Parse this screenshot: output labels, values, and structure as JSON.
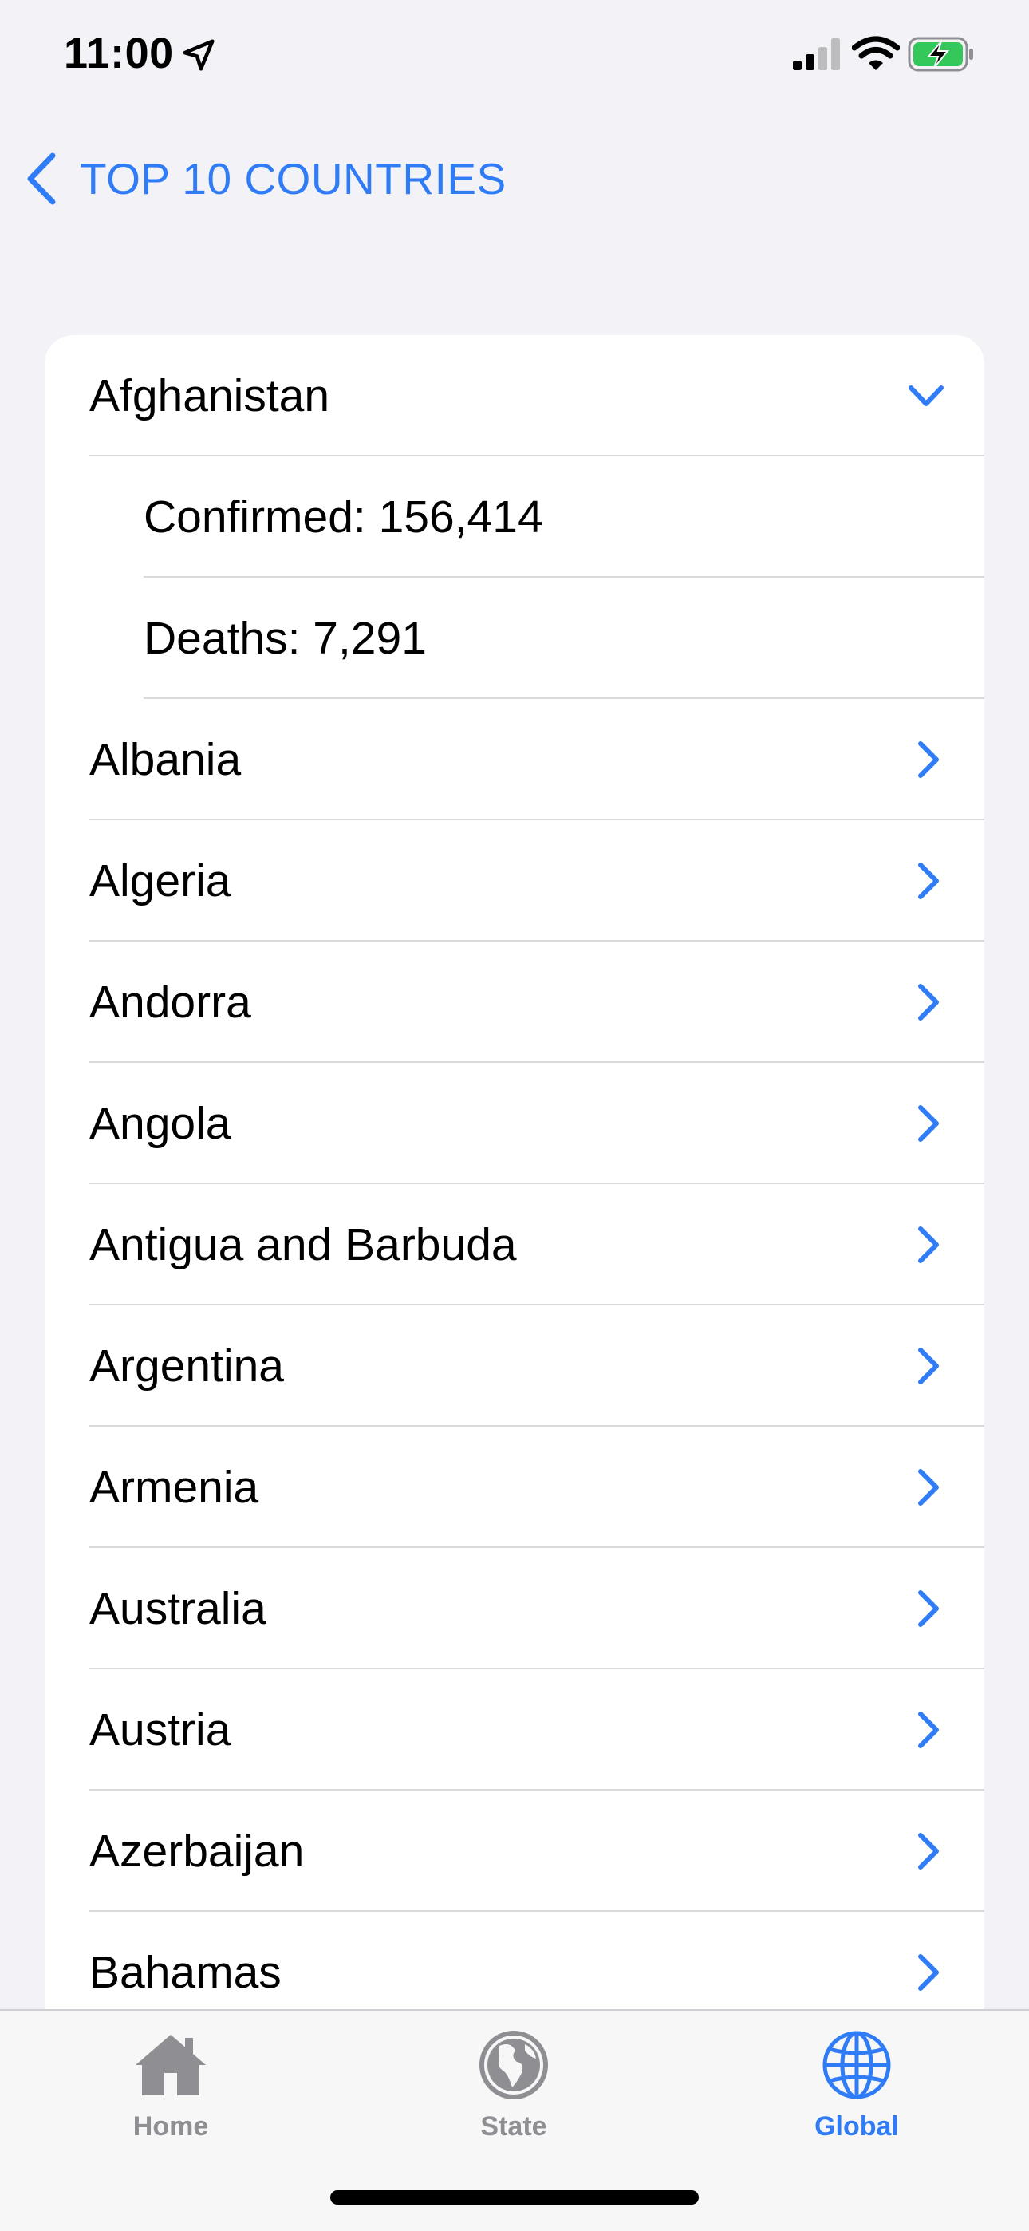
{
  "status_bar": {
    "time": "11:00"
  },
  "nav": {
    "back_title": "TOP 10 COUNTRIES"
  },
  "list": {
    "expanded_country": "Afghanistan",
    "details": [
      {
        "text": "Confirmed: 156,414"
      },
      {
        "text": "Deaths: 7,291"
      }
    ],
    "countries": [
      "Albania",
      "Algeria",
      "Andorra",
      "Angola",
      "Antigua and Barbuda",
      "Argentina",
      "Armenia",
      "Australia",
      "Austria",
      "Azerbaijan",
      "Bahamas"
    ]
  },
  "tab_bar": {
    "tabs": [
      {
        "label": "Home",
        "icon": "house-icon",
        "active": false
      },
      {
        "label": "State",
        "icon": "globe-americas-icon",
        "active": false
      },
      {
        "label": "Global",
        "icon": "globe-grid-icon",
        "active": true
      }
    ]
  },
  "colors": {
    "accent": "#2F7CF6",
    "background": "#F2F2F7",
    "separator": "#D9D9DE",
    "inactive": "#8E8E93"
  }
}
